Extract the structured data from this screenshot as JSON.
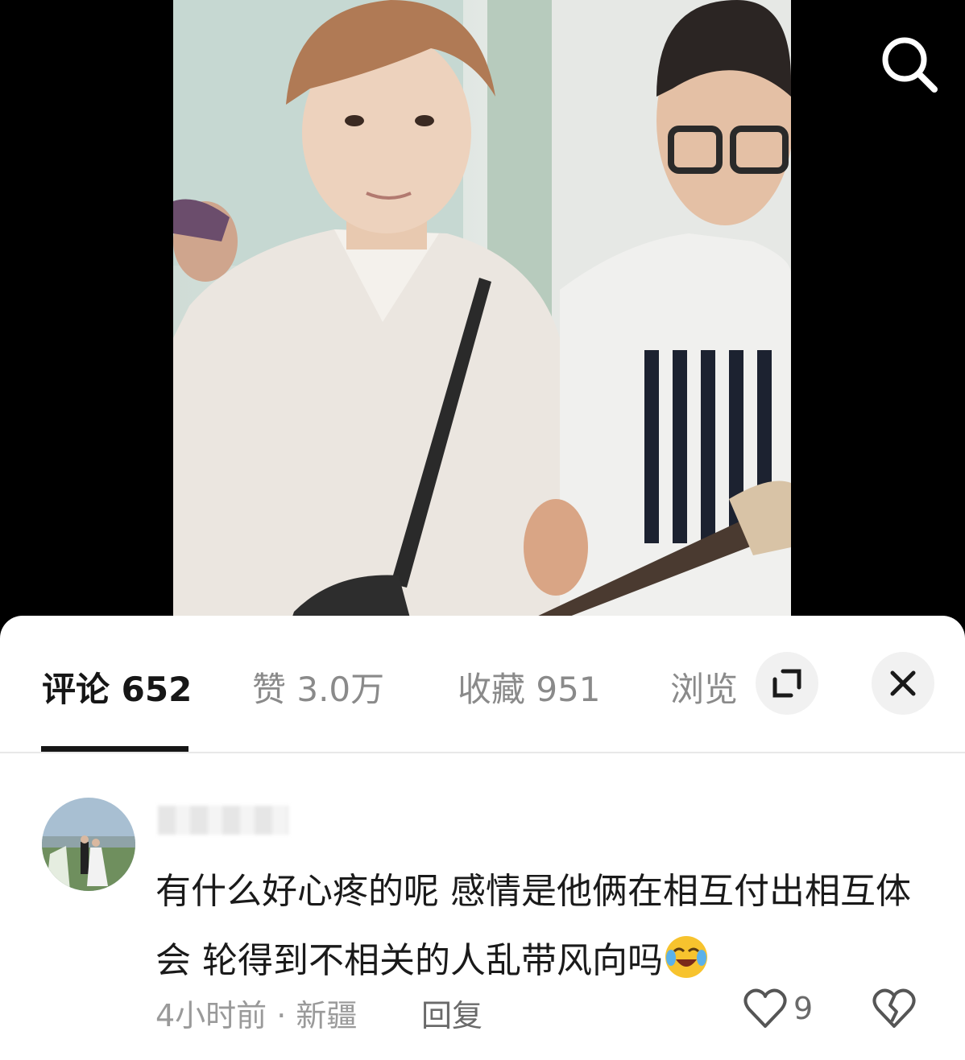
{
  "tabs": [
    {
      "label": "评论 652",
      "active": true
    },
    {
      "label": "赞 3.0万",
      "active": false
    },
    {
      "label": "收藏 951",
      "active": false
    },
    {
      "label": "浏览",
      "active": false
    }
  ],
  "icons": {
    "search": "search-icon",
    "expand": "expand-icon",
    "close": "close-icon",
    "like": "heart-icon",
    "dislike": "broken-heart-icon",
    "emoji": "crying-laughing-emoji"
  },
  "comment": {
    "text": "有什么好心疼的呢 感情是他俩在相互付出相互体会 轮得到不相关的人乱带风向吗",
    "time_location": "4小时前 · 新疆",
    "reply_label": "回复",
    "like_count": "9"
  },
  "colors": {
    "active_tab": "#161616",
    "inactive_tab": "#8a8a8a",
    "meta": "#9a9a9a"
  }
}
